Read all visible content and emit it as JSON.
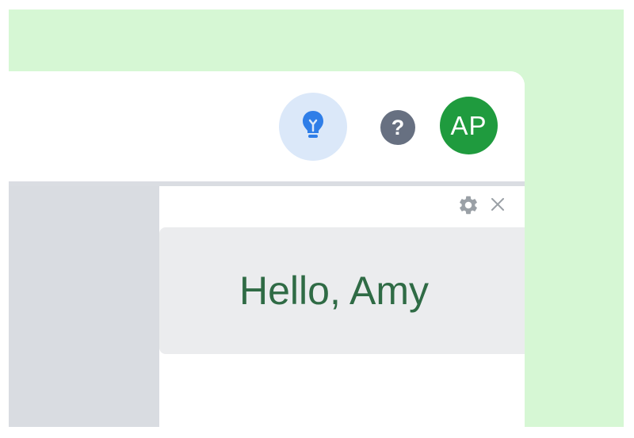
{
  "header": {
    "tip_icon": "lightbulb-icon",
    "help_label": "?",
    "avatar_initials": "AP"
  },
  "panel": {
    "settings_icon": "gear-icon",
    "close_label": "×",
    "greeting": "Hello, Amy"
  },
  "colors": {
    "background_green": "#d6f7d4",
    "tip_bg": "#dbe8f9",
    "tip_icon": "#2f7ee8",
    "help_bg": "#677081",
    "avatar_bg": "#1f9b3e",
    "sidebar_bg": "#d9dce1",
    "card_bg": "#ebecee",
    "greeting_text": "#2f6b45"
  }
}
